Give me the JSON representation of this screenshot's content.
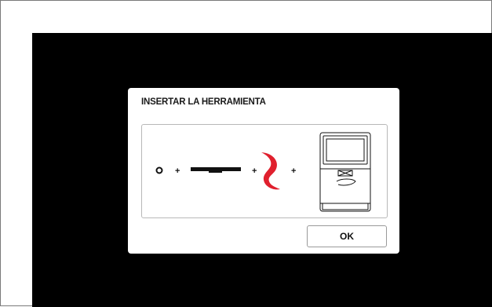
{
  "dialog": {
    "title": "INSERTAR LA HERRAMIENTA",
    "ok_label": "OK"
  },
  "diagram": {
    "separators": [
      "+",
      "+",
      "+",
      "+"
    ],
    "components": [
      "ring-icon",
      "blade-icon",
      "hook-tool-icon",
      "appliance-icon"
    ],
    "accent_color": "#e0202e"
  }
}
